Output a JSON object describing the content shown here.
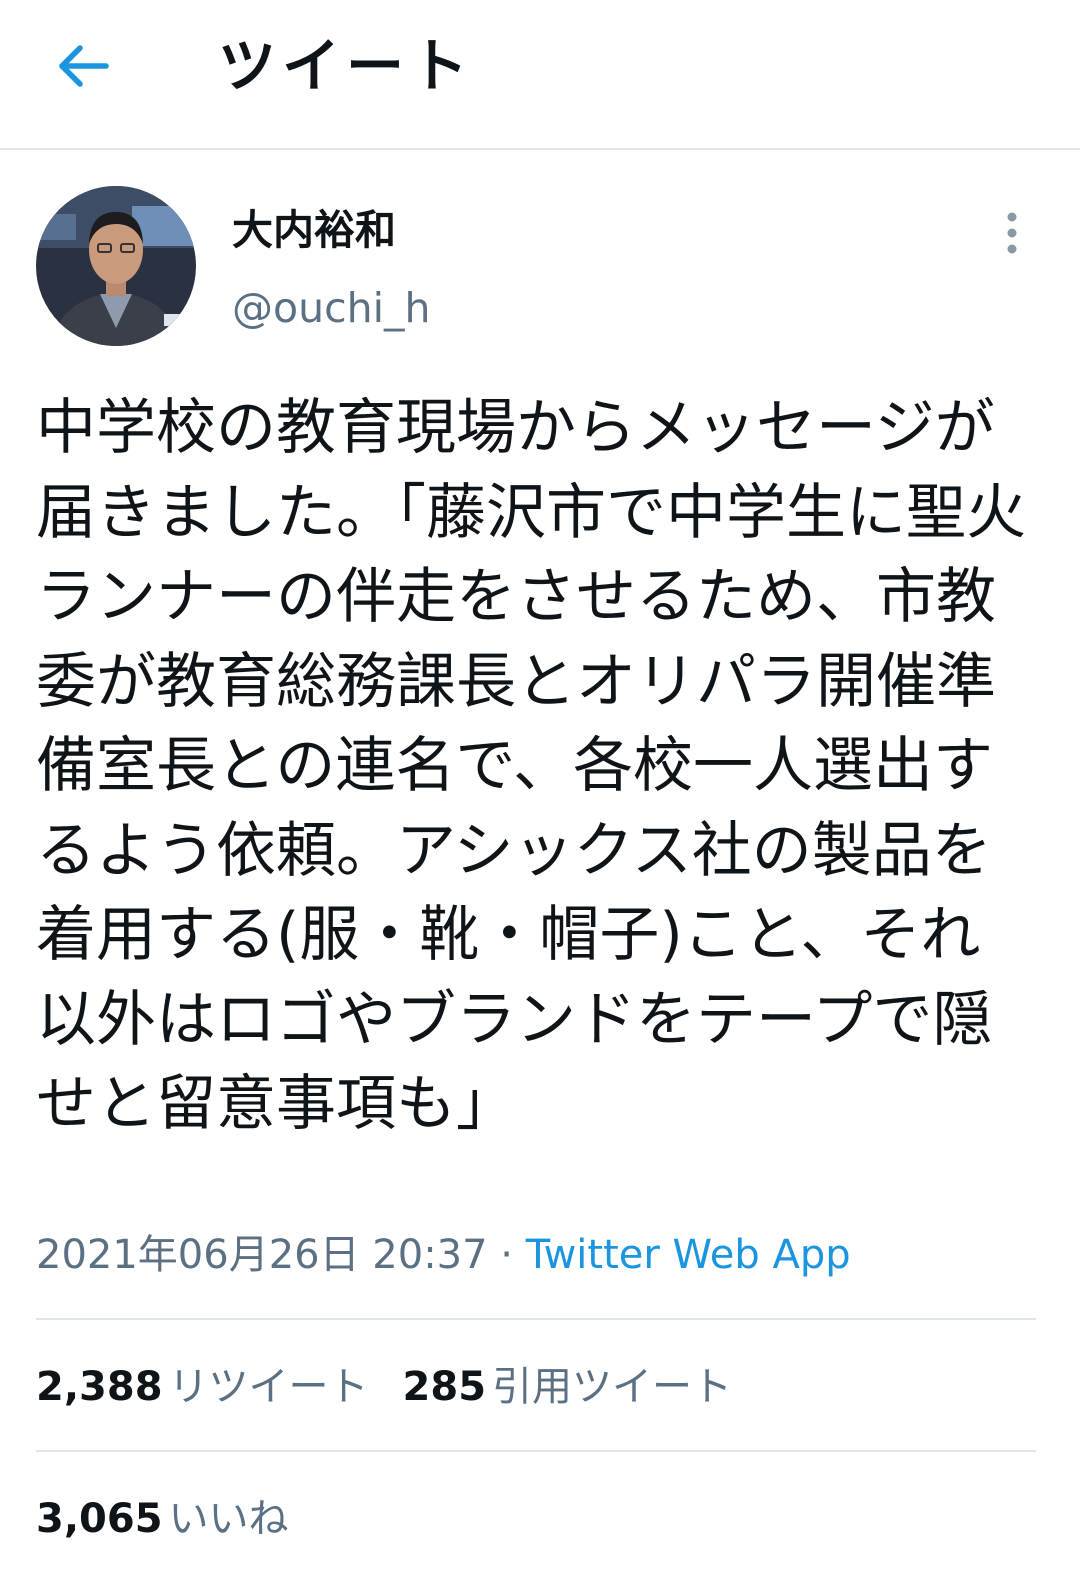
{
  "header": {
    "title": "ツイート",
    "back_icon": "arrow-left-icon",
    "accent_color": "#1b95e0"
  },
  "author": {
    "display_name": "大内裕和",
    "handle": "@ouchi_h",
    "avatar_icon": "profile-photo",
    "more_icon": "more-vertical-icon"
  },
  "tweet": {
    "text": "中学校の教育現場からメッセージが届きました。「藤沢市で中学生に聖火ランナーの伴走をさせるため、市教委が教育総務課長とオリパラ開催準備室長との連名で、各校一人選出するよう依頼。アシックス社の製品を着用する(服・靴・帽子)こと、それ以外はロゴやブランドをテープで隠せと留意事項も」",
    "timestamp": "2021年06月26日 20:37",
    "separator": " · ",
    "source": "Twitter Web App"
  },
  "stats": {
    "retweets_count": "2,388",
    "retweets_label": "リツイート",
    "quotes_count": "285",
    "quotes_label": "引用ツイート",
    "likes_count": "3,065",
    "likes_label": "いいね"
  }
}
